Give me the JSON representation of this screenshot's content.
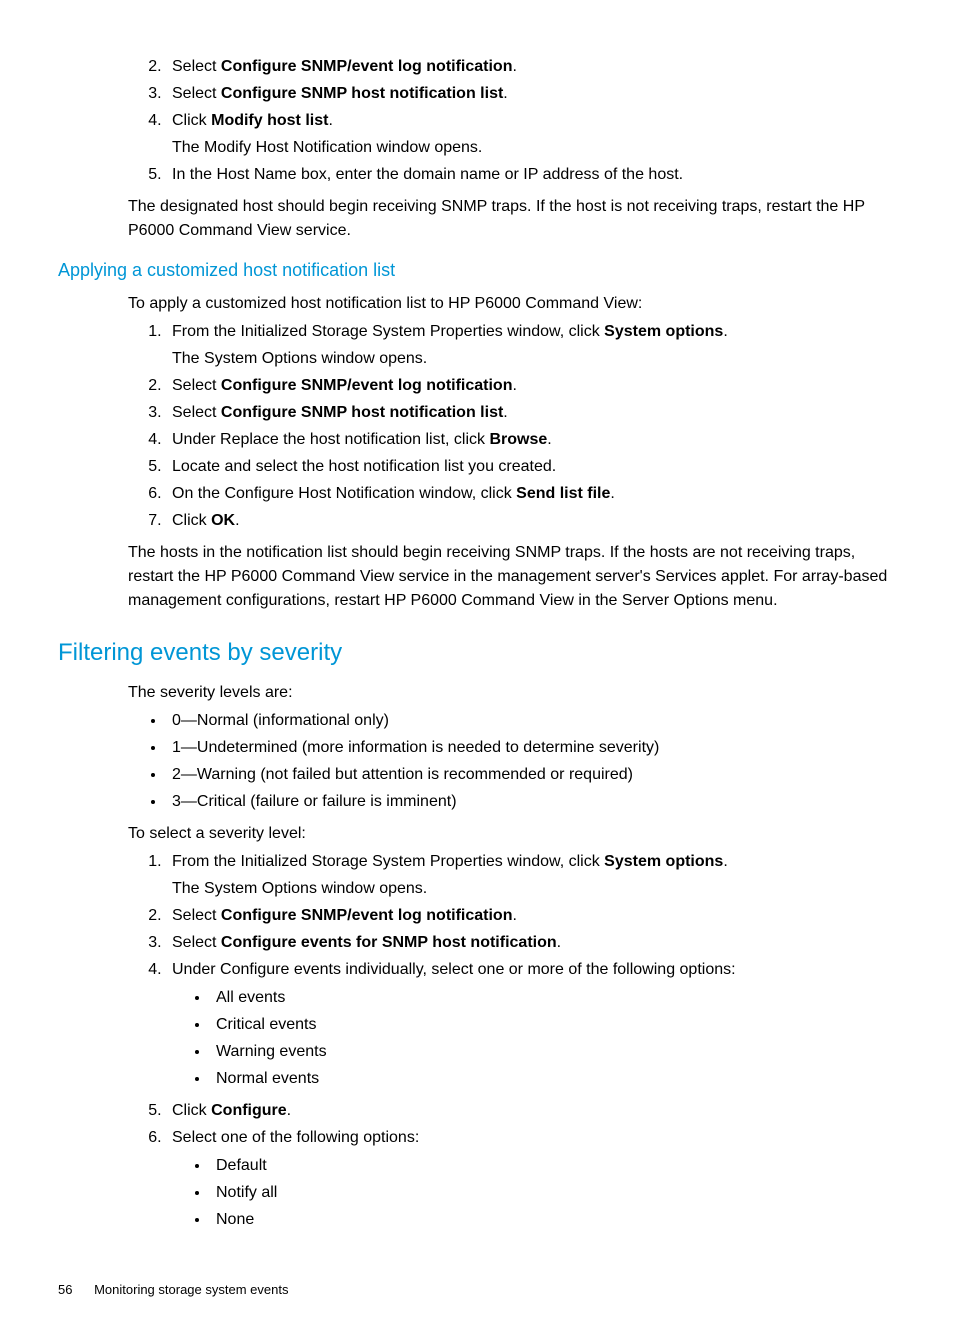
{
  "intro_list": {
    "start": 2,
    "items": [
      {
        "prefix": "Select ",
        "bold": "Configure SNMP/event log notification",
        "suffix": "."
      },
      {
        "prefix": "Select ",
        "bold": "Configure SNMP host notification list",
        "suffix": "."
      },
      {
        "prefix": "Click ",
        "bold": "Modify host list",
        "suffix": ".",
        "sub": "The Modify Host Notification window opens."
      },
      {
        "text": "In the Host Name box, enter the domain name or IP address of the host."
      }
    ]
  },
  "intro_para": "The designated host should begin receiving SNMP traps. If the host is not receiving traps, restart the HP P6000 Command View service.",
  "section1": {
    "title": "Applying a customized host notification list",
    "lead": "To apply a customized host notification list to HP P6000 Command View:",
    "items": [
      {
        "prefix": "From the Initialized Storage System Properties window, click ",
        "bold": "System options",
        "suffix": ".",
        "sub": "The System Options window opens."
      },
      {
        "prefix": "Select ",
        "bold": "Configure SNMP/event log notification",
        "suffix": "."
      },
      {
        "prefix": "Select ",
        "bold": "Configure SNMP host notification list",
        "suffix": "."
      },
      {
        "prefix": "Under Replace the host notification list, click ",
        "bold": "Browse",
        "suffix": "."
      },
      {
        "text": "Locate and select the host notification list you created."
      },
      {
        "prefix": "On the Configure Host Notification window, click ",
        "bold": "Send list file",
        "suffix": "."
      },
      {
        "prefix": "Click ",
        "bold": "OK",
        "suffix": "."
      }
    ],
    "tail": "The hosts in the notification list should begin receiving SNMP traps. If the hosts are not receiving traps, restart the HP P6000 Command View service in the management server's Services applet. For array-based management configurations, restart HP P6000 Command View in the Server Options menu."
  },
  "section2": {
    "title": "Filtering events by severity",
    "lead1": "The severity levels are:",
    "levels": [
      "0—Normal (informational only)",
      "1—Undetermined (more information is needed to determine severity)",
      "2—Warning (not failed but attention is recommended or required)",
      "3—Critical (failure or failure is imminent)"
    ],
    "lead2": "To select a severity level:",
    "items": [
      {
        "prefix": "From the Initialized Storage System Properties window, click ",
        "bold": "System options",
        "suffix": ".",
        "sub": "The System Options window opens."
      },
      {
        "prefix": "Select ",
        "bold": "Configure SNMP/event log notification",
        "suffix": "."
      },
      {
        "prefix": "Select ",
        "bold": "Configure events for SNMP host notification",
        "suffix": "."
      },
      {
        "text": "Under Configure events individually, select one or more of the following options:",
        "bullets": [
          "All events",
          "Critical events",
          "Warning events",
          "Normal events"
        ]
      },
      {
        "prefix": "Click ",
        "bold": "Configure",
        "suffix": "."
      },
      {
        "text": "Select one of the following options:",
        "bullets": [
          "Default",
          "Notify all",
          "None"
        ]
      }
    ]
  },
  "footer": {
    "page": "56",
    "title": "Monitoring storage system events"
  }
}
